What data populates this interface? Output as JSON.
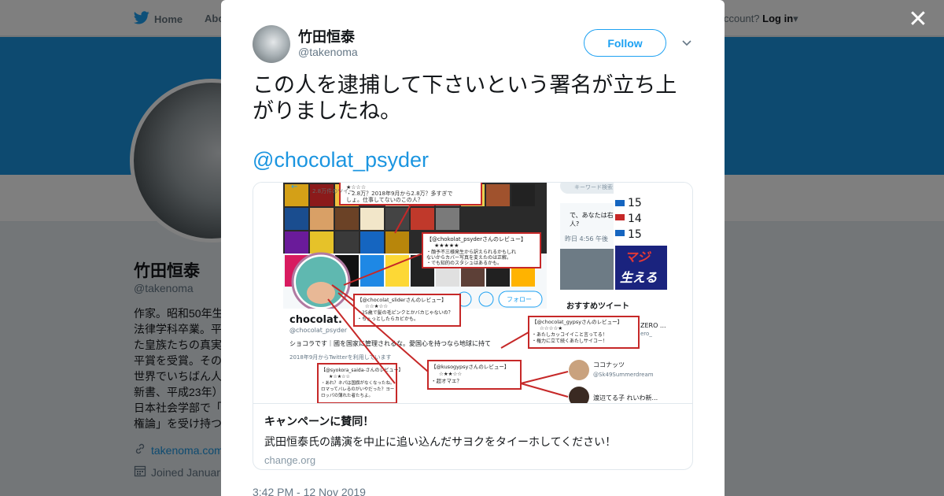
{
  "background": {
    "nav": {
      "home_label": "Home",
      "about_label": "Abo",
      "login_prefix": "ccount?",
      "login_label": "Log in"
    },
    "profile": {
      "name": "竹田恒泰",
      "handle": "@takenoma",
      "bio": "作家。昭和50年生\n法律学科卒業。平\nた皇族たちの真実\n平賞を受賞。その\n世界でいちばん人\n新書、平成23年）\n日本社会学部で「\n権論」を受け持つ",
      "link": "takenoma.com",
      "joined": "Joined Januar"
    },
    "colors": {
      "banner": "#1b95e0",
      "link": "#1b95e0"
    }
  },
  "modal": {
    "author_name": "竹田恒泰",
    "author_handle": "@takenoma",
    "follow_label": "Follow",
    "tweet_text": "この人を逮捕して下さいという署名が立ち上がりましたね。",
    "mention": "@chocolat_psyder",
    "card": {
      "title": "キャンペーンに賛同！",
      "description": "武田恒泰氏の講演を中止に追い込んだサヨクをタイーホしてください！",
      "domain": "change.org",
      "image": {
        "topline_1": "★☆☆☆",
        "topline_2": "・2.8万？2018年9月から2.8万？多すぎで",
        "topline_3": "しょ。仕事してないのこの人？",
        "subtitle": "2.8万件のツイー",
        "search_placeholder": "キーワード検索",
        "trend_question": "で、あなたは右",
        "trend_question2": "人?",
        "trend_nums": [
          "15",
          "14",
          "15"
        ],
        "trend_time": "昨日 4:56 午後",
        "manga_text": "マジ",
        "manga_text2": "生える",
        "review1_title": "【@chokolat_psyderさんのレビュー】",
        "review1_stars": "★★★★★",
        "review1_l1": "・顔予不三様発生から訳えられるかもしれ",
        "review1_l2": "ないからカバー写真を変えたのは正解。",
        "review1_l3": "・でも知的のスタシュはあるかも。",
        "review2_title": "【@chocolat_sliderさんのレビュー】",
        "review2_stars": "☆☆★☆☆",
        "review2_l1": "・25歳で髪の毛ピンクとかバカじゃないの？",
        "review2_l2": "・ちょっとしたらカビかも。",
        "follow_btn": "フォロー",
        "profile_name": "chocolat.",
        "profile_handle": "@chocolat_psyder",
        "profile_bio": "ショコラです｜國を国家に管理されるな。愛国心を持つなら地球に持て",
        "profile_joined": "2018年9月からTwitterを利用しています",
        "review3_title": "【@chocolat_gypsyさんのレビュー】",
        "review3_stars": "☆☆☆☆★",
        "review3_l1": "・あたしカッコイイこと言ってる！",
        "review3_l2": "・権力に立て続くあたしサイコー！",
        "recommend_title": "おすすめツイート",
        "rec_zero": "ZERO ...",
        "rec_zero_handle": "ero_",
        "review4_title": "【@syokora_saida-さんのレビュー】",
        "review4_stars": "★☆★☆☆",
        "review4_l1": "・あれ？ネパは国旗がなくなったね。",
        "review4_l2": "ロマってバレるのがいやだった？ヨー",
        "review4_l3": "ロッパの薄れた者たちよ。",
        "review5_title": "【@kusogypsyさんのレビュー】",
        "review5_stars": "☆★★☆☆",
        "review5_l1": "・超オマエ？",
        "rec1_name": "ココナッツ",
        "rec1_handle": "@Sk49Summerdream",
        "rec2_name": "渡辺てる子 れいわ新..."
      }
    },
    "timestamp": "3:42 PM - 12 Nov 2019"
  }
}
